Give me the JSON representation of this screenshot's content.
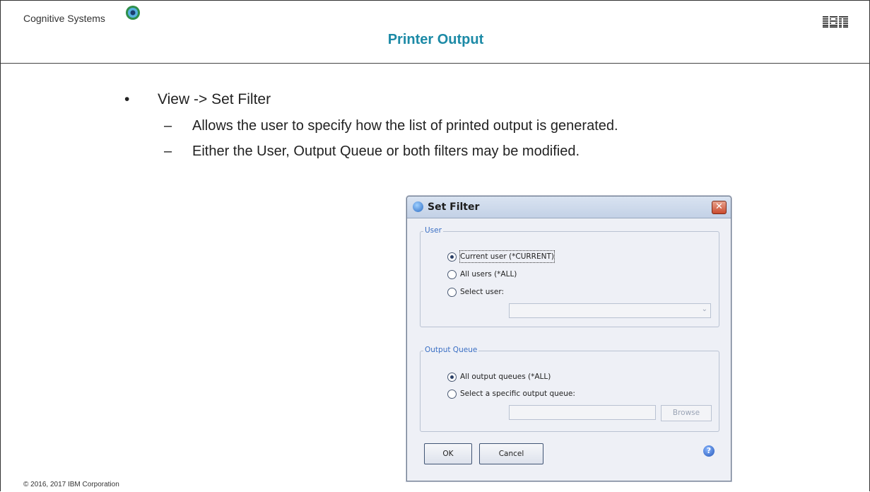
{
  "header": {
    "brand": "Cognitive Systems",
    "title": "Printer Output",
    "ibm_logo": "IBM"
  },
  "content": {
    "bullet": "View -> Set Filter",
    "subbullets": [
      "Allows the user to specify how the list of printed output is generated.",
      "Either the User, Output Queue or both filters may be modified."
    ]
  },
  "dialog": {
    "title": "Set Filter",
    "close_icon": "close-icon",
    "user_group": {
      "legend": "User",
      "options": [
        "Current user (*CURRENT)",
        "All users (*ALL)",
        "Select user:"
      ],
      "selected": "Current user (*CURRENT)",
      "select_user_value": ""
    },
    "queue_group": {
      "legend": "Output Queue",
      "options": [
        "All output queues (*ALL)",
        "Select a specific output queue:"
      ],
      "selected": "All output queues (*ALL)",
      "queue_value": "",
      "browse_label": "Browse"
    },
    "ok_label": "OK",
    "cancel_label": "Cancel",
    "help_icon": "help-icon"
  },
  "footer": {
    "copyright": "© 2016, 2017 IBM Corporation"
  },
  "colors": {
    "title": "#1c8aa6",
    "legend": "#3a6fc4",
    "titlebar": "#c3d1e6"
  }
}
